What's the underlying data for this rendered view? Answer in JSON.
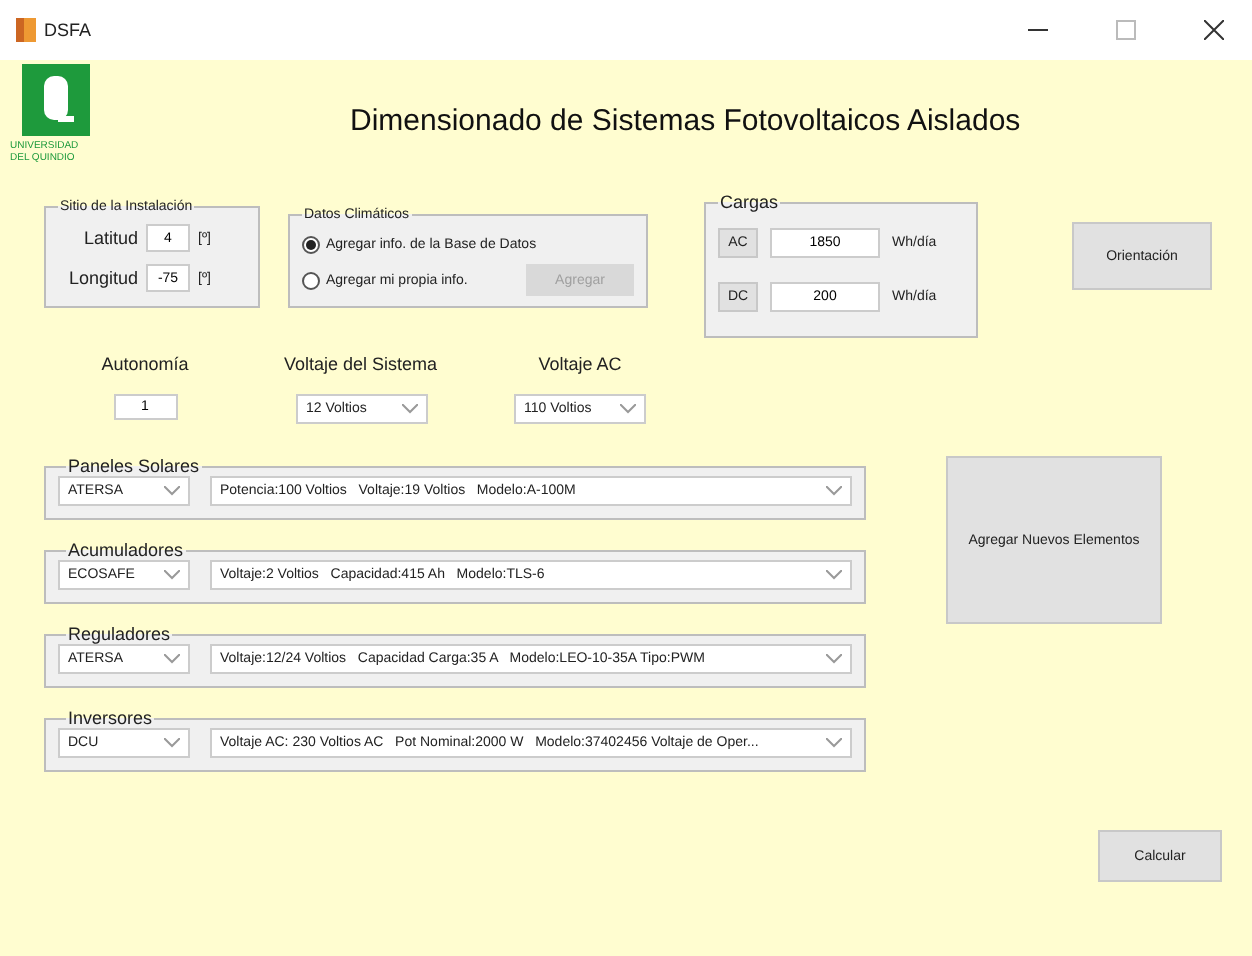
{
  "window": {
    "title": "DSFA"
  },
  "logo": {
    "lines": [
      "UNIVERSIDAD",
      "DEL QUINDIO"
    ]
  },
  "heading": "Dimensionado de Sistemas Fotovoltaicos Aislados",
  "site": {
    "legend": "Sitio de la Instalación",
    "fields": [
      {
        "label": "Latitud",
        "value": "4",
        "unit": "[º]"
      },
      {
        "label": "Longitud",
        "value": "-75",
        "unit": "[º]"
      }
    ]
  },
  "climate": {
    "legend": "Datos Climáticos",
    "options": [
      {
        "label": "Agregar info. de la Base de Datos",
        "selected": true
      },
      {
        "label": "Agregar mi propia info.",
        "selected": false
      }
    ],
    "button": {
      "label": "Agregar",
      "disabled": true
    }
  },
  "loads": {
    "legend": "Cargas",
    "rows": [
      {
        "button": "AC",
        "value": "1850",
        "unit": "Wh/día"
      },
      {
        "button": "DC",
        "value": "200",
        "unit": "Wh/día"
      }
    ]
  },
  "orientation_button": "Orientación",
  "autonomy": {
    "label": "Autonomía",
    "value": "1"
  },
  "system_voltage": {
    "label": "Voltaje del Sistema",
    "value": "12 Voltios"
  },
  "ac_voltage": {
    "label": "Voltaje AC",
    "value": "110 Voltios"
  },
  "components": [
    {
      "legend": "Paneles Solares",
      "brand": "ATERSA",
      "spec": "Potencia:100 Voltios   Voltaje:19 Voltios   Modelo:A-100M"
    },
    {
      "legend": "Acumuladores",
      "brand": "ECOSAFE",
      "spec": "Voltaje:2 Voltios   Capacidad:415 Ah   Modelo:TLS-6"
    },
    {
      "legend": "Reguladores",
      "brand": "ATERSA",
      "spec": "Voltaje:12/24 Voltios   Capacidad Carga:35 A   Modelo:LEO-10-35A Tipo:PWM"
    },
    {
      "legend": "Inversores",
      "brand": "DCU",
      "spec": "Voltaje AC: 230 Voltios AC   Pot Nominal:2000 W   Modelo:37402456 Voltaje de Oper..."
    }
  ],
  "add_button": "Agregar Nuevos Elementos",
  "calculate_button": "Calcular"
}
